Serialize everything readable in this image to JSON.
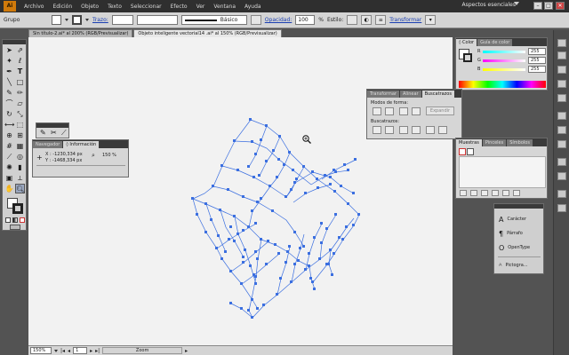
{
  "menubar": {
    "logo": "Ai",
    "items": [
      "Archivo",
      "Edición",
      "Objeto",
      "Texto",
      "Seleccionar",
      "Efecto",
      "Ver",
      "Ventana",
      "Ayuda"
    ],
    "workspace": "Aspectos esenciales"
  },
  "controlbar": {
    "group_label": "Grupo",
    "stroke_link": "Trazo:",
    "brush_label": "Básico",
    "opacity_link": "Opacidad:",
    "opacity_value": "100",
    "opacity_unit": "%",
    "style_label": "Estilo:",
    "transform_link": "Transformar"
  },
  "tabs": [
    {
      "label": "Sin título-2.ai* al 200% (RGB/Previsualizar)",
      "active": false
    },
    {
      "label": "Objeto inteligente vectorial14 .ai* al 150% (RGB/Previsualizar)",
      "active": true
    }
  ],
  "status": {
    "zoom": "150%",
    "page": "1",
    "tool_label": "Zoom"
  },
  "info_panel": {
    "tabs": [
      "Navegador",
      "◊ Información"
    ],
    "x": "X : -1230,334 px",
    "y": "Y : -1468,334 px",
    "zoom": "150 %"
  },
  "color_panel": {
    "tabs": [
      "◊ Color",
      "Guía de color"
    ],
    "rows": [
      {
        "label": "R",
        "value": "255"
      },
      {
        "label": "G",
        "value": "255"
      },
      {
        "label": "B",
        "value": "255"
      }
    ]
  },
  "pathfinder_panel": {
    "tabs": [
      "Transformar",
      "Alinear",
      "Buscatrazos"
    ],
    "modes_label": "Modos de forma:",
    "expand_label": "Expandir",
    "pathfinders_label": "Buscatrazos:"
  },
  "swatches_panel": {
    "tabs": [
      "Muestras",
      "Pinceles",
      "Símbolos"
    ]
  },
  "type_panel": {
    "items": [
      {
        "icon": "A",
        "label": "Carácter"
      },
      {
        "icon": "¶",
        "label": "Párrafo"
      },
      {
        "icon": "O",
        "label": "OpenType"
      },
      {
        "icon": "ᴬ",
        "label": "Pictogra..."
      }
    ]
  },
  "colors": {
    "accent_link": "#1a3fb3",
    "selection": "#3b6fe0"
  }
}
